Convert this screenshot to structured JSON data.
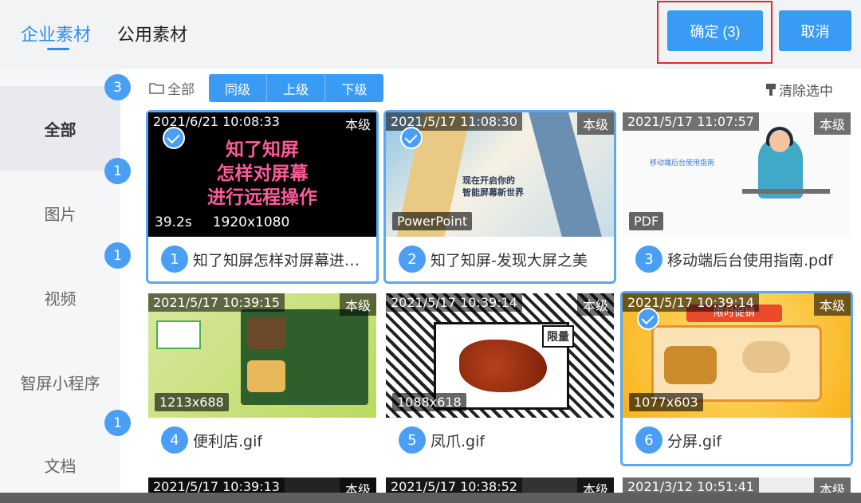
{
  "header": {
    "tabs": [
      {
        "label": "企业素材",
        "active": true
      },
      {
        "label": "公用素材",
        "active": false
      }
    ],
    "confirm_label": "确定 (3)",
    "cancel_label": "取消"
  },
  "sidebar": {
    "items": [
      {
        "label": "全部",
        "active": true
      },
      {
        "label": "图片",
        "active": false
      },
      {
        "label": "视频",
        "active": false
      },
      {
        "label": "智屏小程序",
        "active": false
      },
      {
        "label": "文档",
        "active": false
      }
    ],
    "badges": [
      "3",
      "1",
      "1",
      "1"
    ]
  },
  "toolbar": {
    "breadcrumb": "全部",
    "buttons": [
      "同级",
      "上级",
      "下级"
    ],
    "clear_label": "清除选中"
  },
  "cards": [
    {
      "time": "2021/6/21 10:08:33",
      "level": "本级",
      "selected": true,
      "meta_duration": "39.2s",
      "meta_size": "1920x1080",
      "thumb_text": "知了知屏\n怎样对屏幕\n进行远程操作",
      "num": "1",
      "title": "知了知屏怎样对屏幕进行远程操作"
    },
    {
      "time": "2021/5/17 11:08:30",
      "level": "本级",
      "selected": true,
      "type": "PowerPoint",
      "thumb_text": "现在开启你的\n智能屏幕新世界",
      "num": "2",
      "title": "知了知屏-发现大屏之美"
    },
    {
      "time": "2021/5/17 11:07:57",
      "level": "本级",
      "selected": false,
      "type": "PDF",
      "thumb_text": "移动端后台使用指南",
      "num": "3",
      "title": "移动端后台使用指南.pdf"
    },
    {
      "time": "2021/5/17 10:39:15",
      "level": "本级",
      "selected": false,
      "size": "1213x688",
      "num": "4",
      "title": "便利店.gif"
    },
    {
      "time": "2021/5/17 10:39:14",
      "level": "本级",
      "selected": false,
      "size": "1088x618",
      "thumb_label": "限量",
      "num": "5",
      "title": "凤爪.gif"
    },
    {
      "time": "2021/5/17 10:39:14",
      "level": "本级",
      "selected": true,
      "size": "1077x603",
      "thumb_label": "限时促销",
      "num": "6",
      "title": "分屏.gif"
    }
  ],
  "partial_cards": [
    {
      "time": "2021/5/17 10:39:13",
      "level": "本级"
    },
    {
      "time": "2021/5/17 10:38:52",
      "level": "本级"
    },
    {
      "time": "2021/3/12 10:51:41",
      "level": "本级"
    }
  ],
  "colors": {
    "accent": "#3a9bf5",
    "highlight": "#e8262b"
  }
}
